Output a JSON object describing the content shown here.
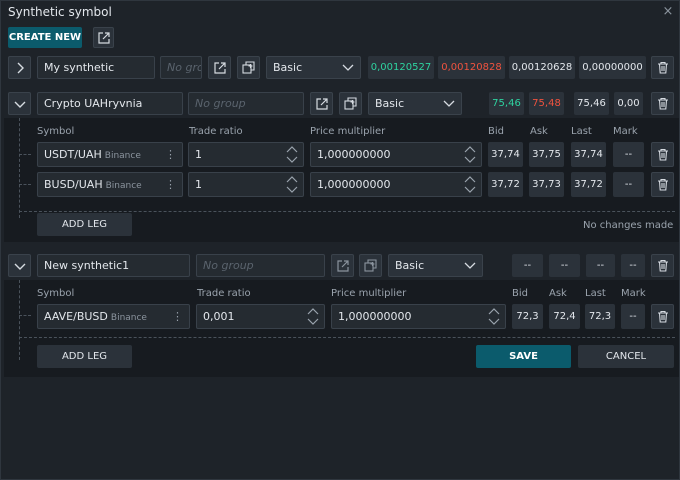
{
  "dialog": {
    "title": "Synthetic symbol",
    "close": "×"
  },
  "toolbar": {
    "create_new_label": "CREATE NEW"
  },
  "synthetics": [
    {
      "name": "My synthetic",
      "group_placeholder": "No group",
      "type": "Basic",
      "bid": "0,00120527",
      "ask": "0,00120828",
      "last": "0,00120628",
      "mark": "0,00000000"
    },
    {
      "name": "Crypto UAHryvnia",
      "group_placeholder": "No group",
      "type": "Basic",
      "bid": "75,46",
      "ask": "75,48",
      "last": "75,46",
      "mark": "0,00",
      "columns": {
        "symbol": "Symbol",
        "trade_ratio": "Trade ratio",
        "price_multiplier": "Price multiplier",
        "bid": "Bid",
        "ask": "Ask",
        "last": "Last",
        "mark": "Mark"
      },
      "legs": [
        {
          "symbol": "USDT/UAH",
          "exchange": "Binance",
          "trade_ratio": "1",
          "price_multiplier": "1,000000000",
          "bid": "37,74",
          "ask": "37,75",
          "last": "37,74",
          "mark": "--"
        },
        {
          "symbol": "BUSD/UAH",
          "exchange": "Binance",
          "trade_ratio": "1",
          "price_multiplier": "1,000000000",
          "bid": "37,72",
          "ask": "37,73",
          "last": "37,72",
          "mark": "--"
        }
      ],
      "add_leg_label": "ADD LEG",
      "status": "No changes made"
    },
    {
      "name": "New synthetic1",
      "group_placeholder": "No group",
      "type": "Basic",
      "bid": "--",
      "ask": "--",
      "last": "--",
      "mark": "--",
      "columns": {
        "symbol": "Symbol",
        "trade_ratio": "Trade ratio",
        "price_multiplier": "Price multiplier",
        "bid": "Bid",
        "ask": "Ask",
        "last": "Last",
        "mark": "Mark"
      },
      "legs": [
        {
          "symbol": "AAVE/BUSD",
          "exchange": "Binance",
          "trade_ratio": "0,001",
          "price_multiplier": "1,000000000",
          "bid": "72,3",
          "ask": "72,4",
          "last": "72,3",
          "mark": "--"
        }
      ],
      "add_leg_label": "ADD LEG",
      "save_label": "SAVE",
      "cancel_label": "CANCEL"
    }
  ]
}
